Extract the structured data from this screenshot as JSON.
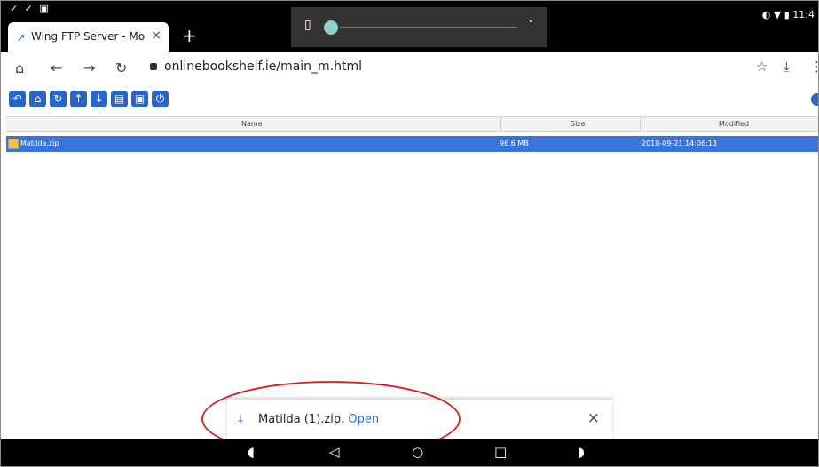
{
  "status": {
    "left_icons": "✓ ✓ ▣",
    "right_text": "◐ ▼ ▮ 11:4"
  },
  "browser": {
    "tab_title": "Wing FTP Server - Mo",
    "tab_close": "×",
    "new_tab": "+",
    "url": "onlinebookshelf.ie/main_m.html"
  },
  "media": {
    "chevron": "˅"
  },
  "ftp": {
    "toolbar": [
      "↶",
      "⌂",
      "↻",
      "↑",
      "↓",
      "▤",
      "▣",
      "⏻"
    ],
    "columns": [
      "Name",
      "Size",
      "Modified"
    ],
    "rows": [
      {
        "name": "Matilda.zip",
        "size": "96.6 MB",
        "modified": "2018-09-21 14:06:13"
      }
    ]
  },
  "download": {
    "filename": "Matilda (1).zip.",
    "open_label": "Open",
    "close": "×"
  },
  "colors": {
    "accent": "#1a73e8",
    "selected_row": "#3a73d9",
    "annotation": "#d62020"
  }
}
